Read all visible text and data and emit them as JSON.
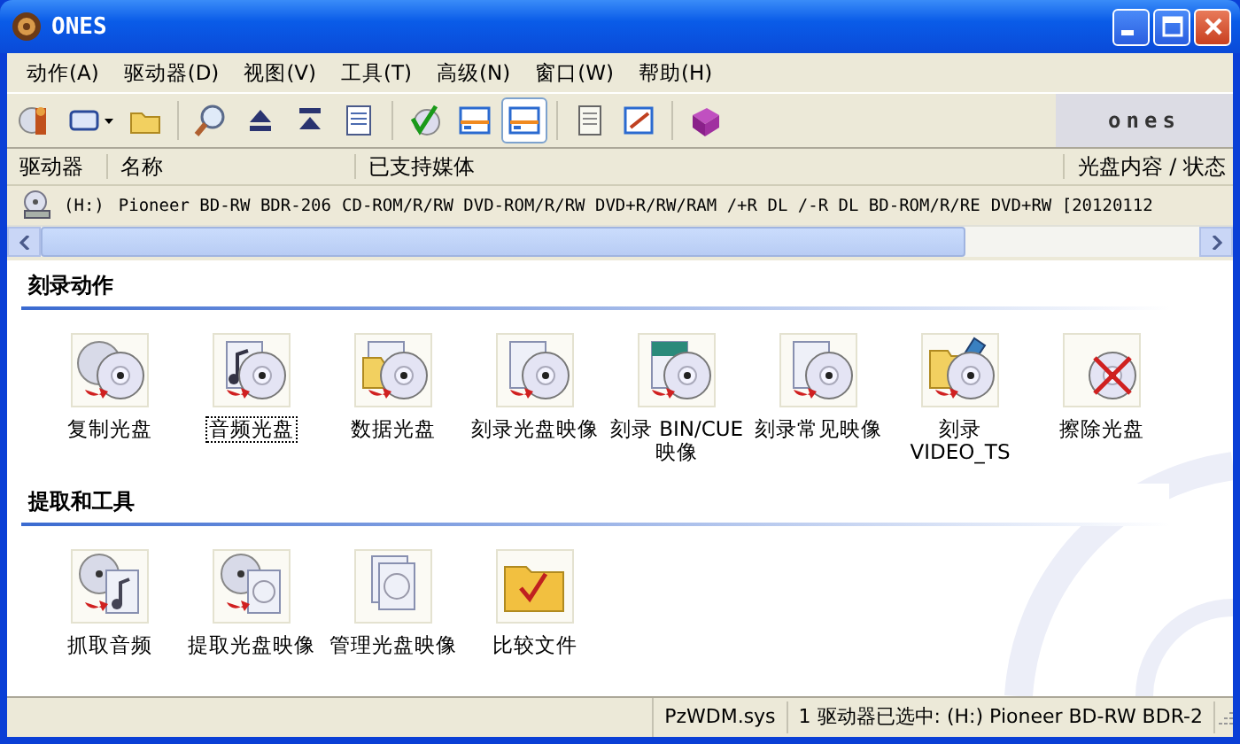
{
  "window": {
    "title": "ONES"
  },
  "menu": [
    "动作(A)",
    "驱动器(D)",
    "视图(V)",
    "工具(T)",
    "高级(N)",
    "窗口(W)",
    "帮助(H)"
  ],
  "toolbar": [
    {
      "kind": "wizard",
      "selected": false,
      "caret": false
    },
    {
      "kind": "window",
      "selected": false,
      "caret": true
    },
    {
      "kind": "folder",
      "selected": false,
      "caret": false
    },
    {
      "kind": "sep"
    },
    {
      "kind": "search",
      "selected": false,
      "caret": false
    },
    {
      "kind": "eject",
      "selected": false,
      "caret": false
    },
    {
      "kind": "load",
      "selected": false,
      "caret": false
    },
    {
      "kind": "document",
      "selected": false,
      "caret": false
    },
    {
      "kind": "sep"
    },
    {
      "kind": "check",
      "selected": false,
      "caret": false
    },
    {
      "kind": "panel",
      "selected": false,
      "caret": false
    },
    {
      "kind": "panel",
      "selected": true,
      "caret": false
    },
    {
      "kind": "sep"
    },
    {
      "kind": "notepad",
      "selected": false,
      "caret": false
    },
    {
      "kind": "edit",
      "selected": false,
      "caret": false
    },
    {
      "kind": "sep"
    },
    {
      "kind": "help",
      "selected": false,
      "caret": false
    }
  ],
  "toolbar_logo": "ones",
  "drive_list": {
    "columns": [
      "驱动器",
      "名称",
      "已支持媒体",
      "光盘内容 / 状态"
    ],
    "rows": [
      {
        "drive": "(H:)",
        "name": "Pioneer BD-RW BDR-206",
        "media": "CD-ROM/R/RW DVD-ROM/R/RW DVD+R/RW/RAM /+R DL /-R DL  BD-ROM/R/RE",
        "status": "DVD+RW [20120112"
      }
    ]
  },
  "sections": [
    {
      "title": "刻录动作",
      "items": [
        {
          "kind": "copy",
          "label": "复制光盘",
          "selected": false
        },
        {
          "kind": "audio",
          "label": "音频光盘",
          "selected": true
        },
        {
          "kind": "data",
          "label": "数据光盘",
          "selected": false
        },
        {
          "kind": "image",
          "label": "刻录光盘映像",
          "selected": false
        },
        {
          "kind": "bincue",
          "label": "刻录 BIN/CUE 映像",
          "selected": false
        },
        {
          "kind": "common",
          "label": "刻录常见映像",
          "selected": false
        },
        {
          "kind": "video",
          "label": "刻录 VIDEO_TS",
          "selected": false
        },
        {
          "kind": "erase",
          "label": "擦除光盘",
          "selected": false
        }
      ]
    },
    {
      "title": "提取和工具",
      "items": [
        {
          "kind": "rip",
          "label": "抓取音频",
          "selected": false
        },
        {
          "kind": "extract",
          "label": "提取光盘映像",
          "selected": false
        },
        {
          "kind": "manage",
          "label": "管理光盘映像",
          "selected": false
        },
        {
          "kind": "compare",
          "label": "比较文件",
          "selected": false
        }
      ]
    }
  ],
  "status_bar": [
    "PzWDM.sys",
    "1 驱动器已选中: (H:) Pioneer BD-RW BDR-2"
  ]
}
